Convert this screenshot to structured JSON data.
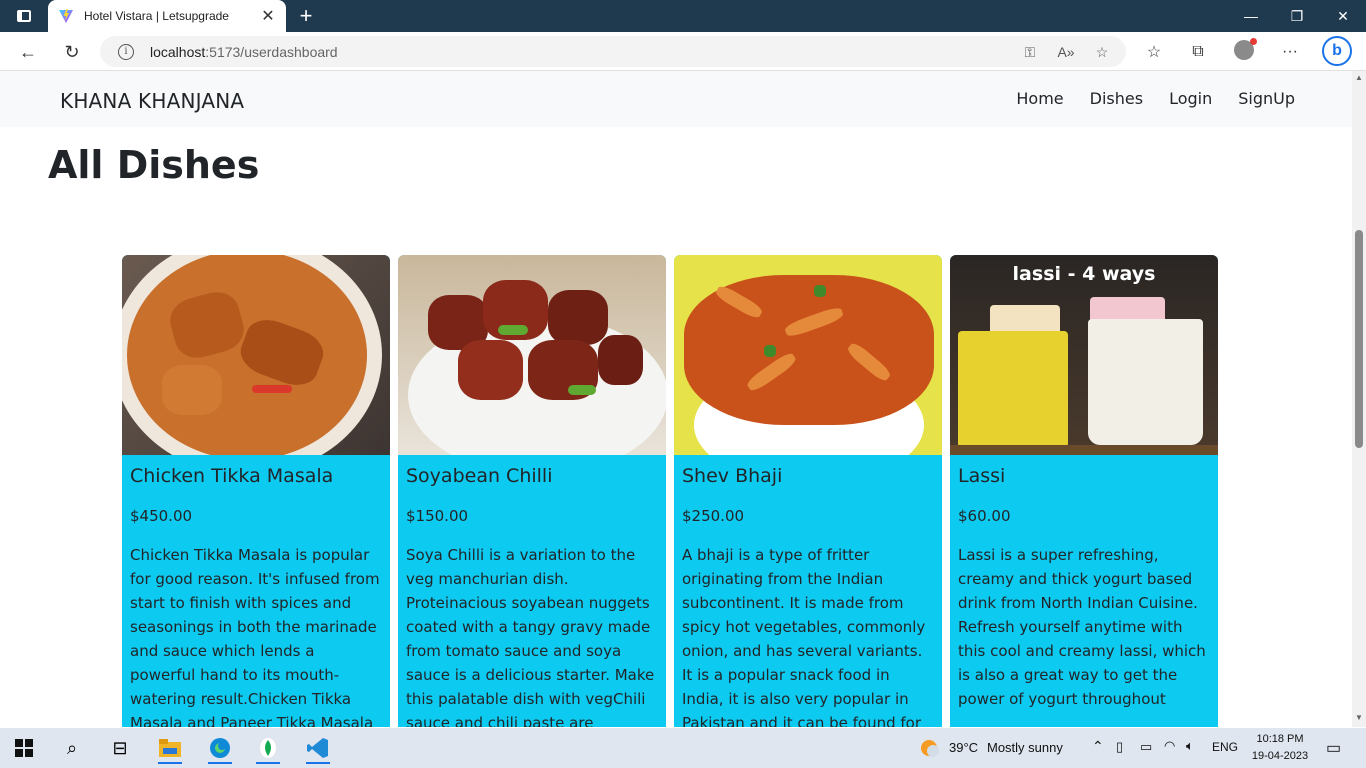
{
  "browser": {
    "tab_title": "Hotel Vistara | Letsupgrade",
    "url_host": "localhost",
    "url_rest": ":5173/userdashboard"
  },
  "navbar": {
    "brand": "KHANA KHANJANA",
    "links": [
      "Home",
      "Dishes",
      "Login",
      "SignUp"
    ]
  },
  "heading": "All Dishes",
  "dishes": [
    {
      "title": "Chicken Tikka Masala",
      "price": "$450.00",
      "description": "Chicken Tikka Masala is popular for good reason. It's infused from start to finish with spices and seasonings in both the marinade and sauce which lends a powerful hand to its mouth-watering result.Chicken Tikka Masala and Paneer Tikka Masala are two dishes which are"
    },
    {
      "title": "Soyabean Chilli",
      "price": "$150.00",
      "description": "Soya Chilli is a variation to the veg manchurian dish. Proteinacious soyabean nuggets coated with a tangy gravy made from tomato sauce and soya sauce is a delicious starter. Make this palatable dish with vegChili sauce and chili paste are condiments prepared with chili"
    },
    {
      "title": "Shev Bhaji",
      "price": "$250.00",
      "description": "A bhaji is a type of fritter originating from the Indian subcontinent. It is made from spicy hot vegetables, commonly onion, and has several variants. It is a popular snack food in India, it is also very popular in Pakistan and it can be found for sale in street-side"
    },
    {
      "title": "Lassi",
      "price": "$60.00",
      "description": "Lassi is a super refreshing, creamy and thick yogurt based drink from North Indian Cuisine. Refresh yourself anytime with this cool and creamy lassi, which is also a great way to get the power of yogurt throughout",
      "image_text": "lassi - 4 ways"
    }
  ],
  "taskbar": {
    "weather_temp": "39°C",
    "weather_text": "Mostly sunny",
    "language": "ENG",
    "time": "10:18 PM",
    "date": "19-04-2023"
  },
  "colors": {
    "card_bg": "#0dcaf0",
    "navbar_bg": "#f8f9fa",
    "titlebar_bg": "#1f3a4f"
  }
}
